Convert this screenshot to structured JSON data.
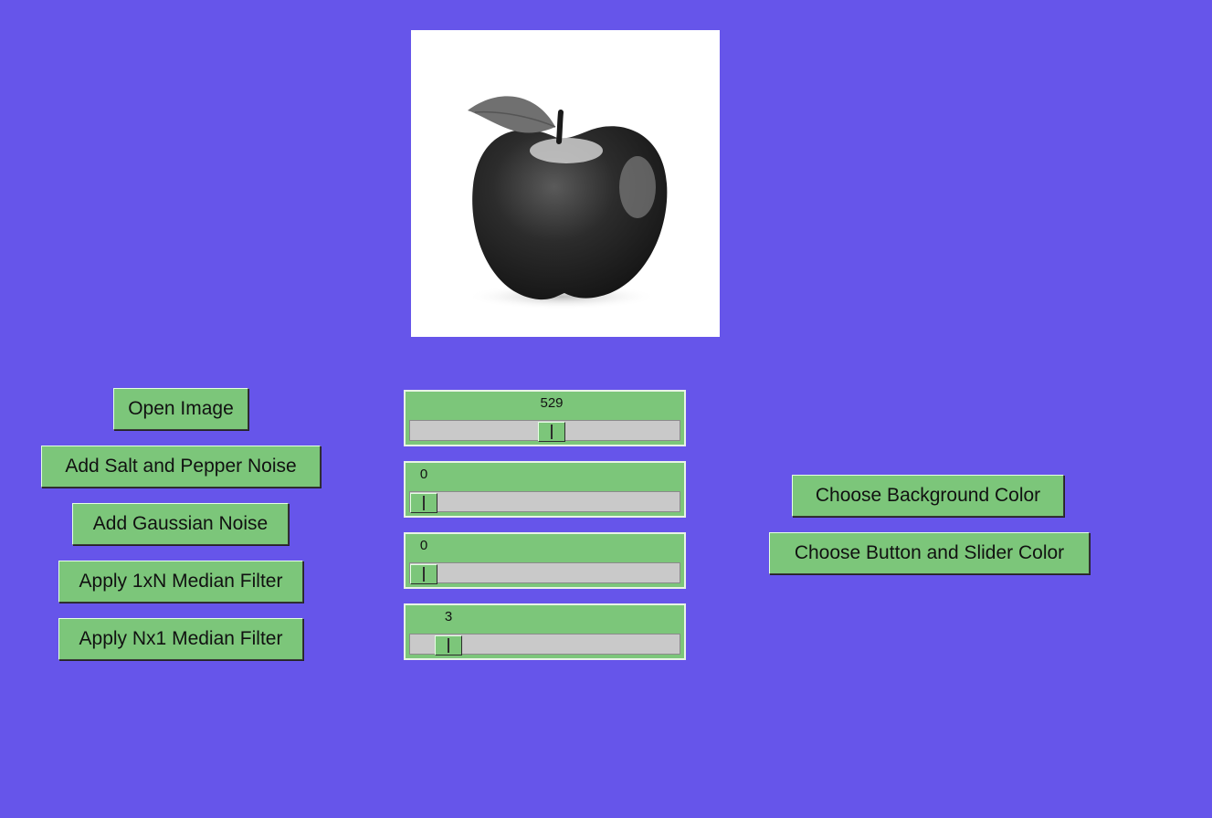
{
  "colors": {
    "background": "#6655ea",
    "button": "#7cc67a",
    "slider_track": "#c9c9c9"
  },
  "left_buttons": {
    "open_image": "Open Image",
    "salt_pepper": "Add Salt and Pepper Noise",
    "gaussian": "Add Gaussian Noise",
    "median_1xn": "Apply 1xN Median Filter",
    "median_nx1": "Apply Nx1 Median Filter"
  },
  "right_buttons": {
    "bg_color": "Choose Background Color",
    "btn_slider_color": "Choose Button and Slider Color"
  },
  "image": {
    "subject": "grayscale-apple"
  },
  "sliders": [
    {
      "value": "529",
      "fraction": 0.53
    },
    {
      "value": "0",
      "fraction": 0.0
    },
    {
      "value": "0",
      "fraction": 0.0
    },
    {
      "value": "3",
      "fraction": 0.1
    }
  ]
}
